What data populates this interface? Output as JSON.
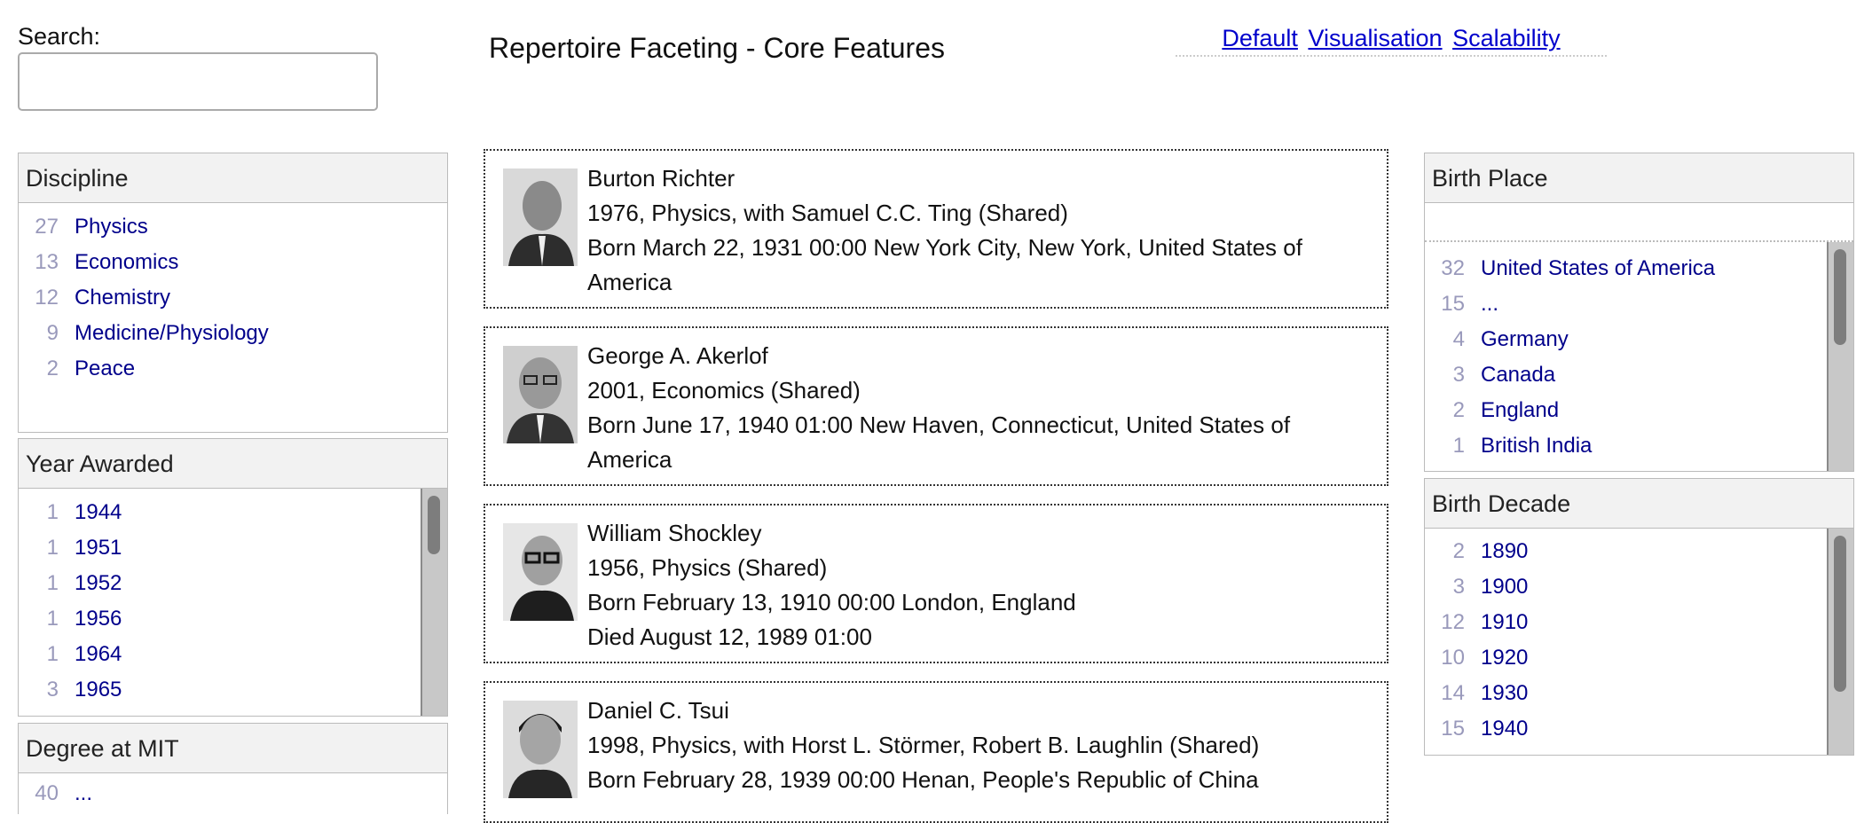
{
  "search": {
    "label": "Search:",
    "value": "",
    "placeholder": ""
  },
  "title": "Repertoire Faceting - Core Features",
  "nav": {
    "links": [
      "Default",
      "Visualisation",
      "Scalability"
    ]
  },
  "facets": {
    "discipline": {
      "title": "Discipline",
      "items": [
        {
          "count": "27",
          "label": "Physics"
        },
        {
          "count": "13",
          "label": "Economics"
        },
        {
          "count": "12",
          "label": "Chemistry"
        },
        {
          "count": "9",
          "label": "Medicine/Physiology"
        },
        {
          "count": "2",
          "label": "Peace"
        }
      ]
    },
    "year": {
      "title": "Year Awarded",
      "items": [
        {
          "count": "1",
          "label": "1944"
        },
        {
          "count": "1",
          "label": "1951"
        },
        {
          "count": "1",
          "label": "1952"
        },
        {
          "count": "1",
          "label": "1956"
        },
        {
          "count": "1",
          "label": "1964"
        },
        {
          "count": "3",
          "label": "1965"
        }
      ]
    },
    "degree": {
      "title": "Degree at MIT",
      "items": [
        {
          "count": "40",
          "label": "..."
        }
      ]
    },
    "birthplace": {
      "title": "Birth Place",
      "items": [
        {
          "count": "32",
          "label": "United States of America"
        },
        {
          "count": "15",
          "label": "..."
        },
        {
          "count": "4",
          "label": "Germany"
        },
        {
          "count": "3",
          "label": "Canada"
        },
        {
          "count": "2",
          "label": "England"
        },
        {
          "count": "1",
          "label": "British India"
        }
      ]
    },
    "decade": {
      "title": "Birth Decade",
      "items": [
        {
          "count": "2",
          "label": "1890"
        },
        {
          "count": "3",
          "label": "1900"
        },
        {
          "count": "12",
          "label": "1910"
        },
        {
          "count": "10",
          "label": "1920"
        },
        {
          "count": "14",
          "label": "1930"
        },
        {
          "count": "15",
          "label": "1940"
        }
      ]
    }
  },
  "results": [
    {
      "name": "Burton Richter",
      "award": "1976, Physics, with Samuel C.C. Ting (Shared)",
      "born": "Born March 22, 1931 00:00 New York City, New York, United States of America",
      "died": ""
    },
    {
      "name": "George A. Akerlof",
      "award": "2001, Economics (Shared)",
      "born": "Born June 17, 1940 01:00 New Haven, Connecticut, United States of America",
      "died": ""
    },
    {
      "name": "William Shockley",
      "award": "1956, Physics (Shared)",
      "born": "Born February 13, 1910 00:00 London, England",
      "died": "Died August 12, 1989 01:00"
    },
    {
      "name": "Daniel C. Tsui",
      "award": "1998, Physics, with Horst L. Störmer, Robert B. Laughlin (Shared)",
      "born": "Born February 28, 1939 00:00 Henan, People's Republic of China",
      "died": ""
    }
  ],
  "colors": {
    "link": "#00008b",
    "count": "#9999bb",
    "facet_header": "#f2f2f2"
  }
}
